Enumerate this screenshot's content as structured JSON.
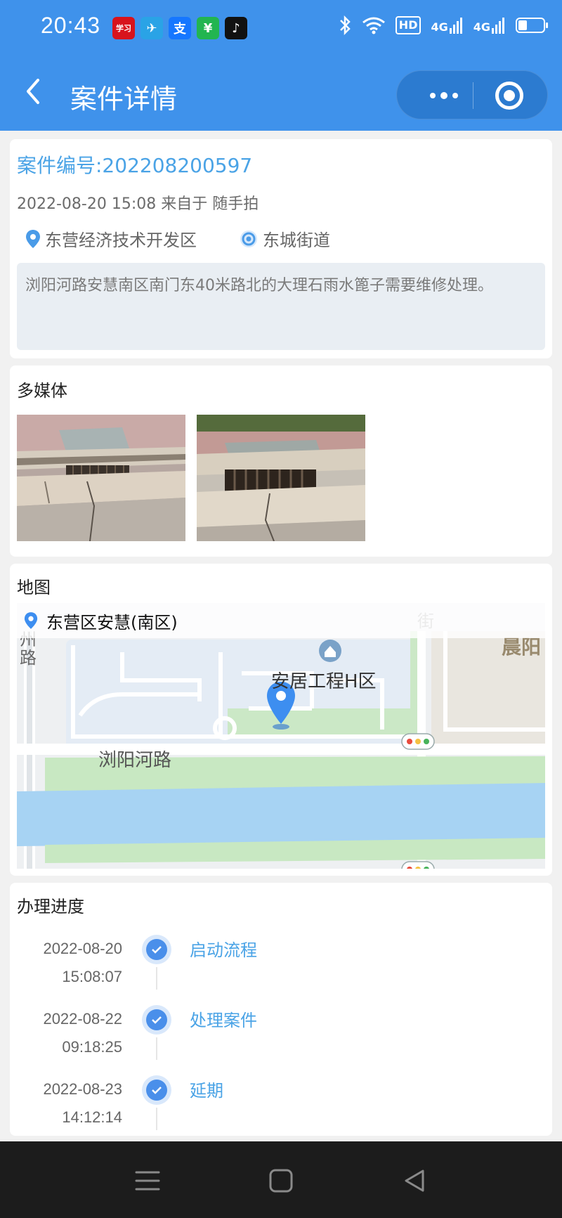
{
  "status_bar": {
    "time": "20:43",
    "app_icons": [
      {
        "name": "xuexi-app-icon",
        "glyph": "学习",
        "color": "#d8131c"
      },
      {
        "name": "telegram-app-icon",
        "glyph": "✈",
        "color": "#2aa3e6"
      },
      {
        "name": "alipay-app-icon",
        "glyph": "支",
        "color": "#1677ff"
      },
      {
        "name": "wechat-pay-app-icon",
        "glyph": "¥",
        "color": "#22b550"
      },
      {
        "name": "tiktok-app-icon",
        "glyph": "♪",
        "color": "#111111"
      }
    ],
    "hd_badge": "HD",
    "network_1": "4G",
    "network_2": "4G",
    "battery_level": 0.35
  },
  "nav": {
    "title": "案件详情"
  },
  "case": {
    "number": "案件编号:202208200597",
    "meta": "2022-08-20 15:08 来自于 随手拍",
    "district": "东营经济技术开发区",
    "street": "东城街道",
    "description": "浏阳河路安慧南区南门东40米路北的大理石雨水篦子需要维修处理。"
  },
  "media": {
    "title": "多媒体"
  },
  "map": {
    "title": "地图",
    "location_label": "东营区安慧(南区)",
    "labels": {
      "community": "安居工程H区",
      "road": "浏阳河路",
      "chenyang": "晨阳",
      "jie": "街",
      "lu": "路",
      "zhou": "州"
    }
  },
  "progress": {
    "title": "办理进度",
    "steps": [
      {
        "date": "2022-08-20",
        "time": "15:08:07",
        "label": "启动流程"
      },
      {
        "date": "2022-08-22",
        "time": "09:18:25",
        "label": "处理案件"
      },
      {
        "date": "2022-08-23",
        "time": "14:12:14",
        "label": "延期"
      }
    ]
  },
  "colors": {
    "primary": "#3f92eb",
    "link": "#4aa3e6",
    "step_dot": "#4a8fea"
  }
}
